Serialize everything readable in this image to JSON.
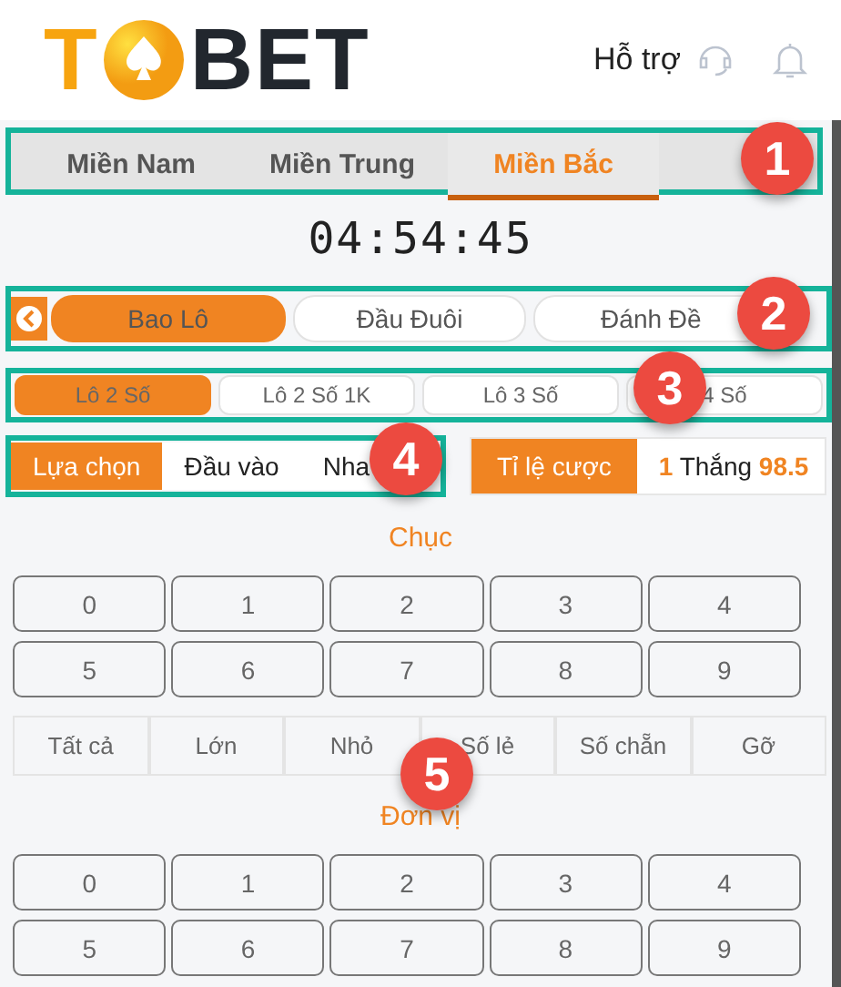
{
  "logo": {
    "before": "T",
    "after": "BET"
  },
  "header": {
    "support": "Hỗ trợ"
  },
  "region_tabs": [
    {
      "label": "Miền Nam",
      "selected": false
    },
    {
      "label": "Miền Trung",
      "selected": false
    },
    {
      "label": "Miền Bắc",
      "selected": true
    }
  ],
  "timer": "04:54:45",
  "bet_types": [
    {
      "label": "Bao Lô",
      "selected": true
    },
    {
      "label": "Đầu Đuôi",
      "selected": false
    },
    {
      "label": "Đánh Đề",
      "selected": false
    }
  ],
  "sub_types": [
    {
      "label": "Lô 2 Số",
      "selected": true
    },
    {
      "label": "Lô 2 Số 1K",
      "selected": false
    },
    {
      "label": "Lô 3 Số",
      "selected": false
    },
    {
      "label": "4 Số",
      "selected": false
    }
  ],
  "input_modes": [
    {
      "label": "Lựa chọn",
      "selected": true
    },
    {
      "label": "Đầu vào",
      "selected": false
    },
    {
      "label": "Nha",
      "selected": false
    }
  ],
  "odds": {
    "label": "Tỉ lệ cược",
    "value": "**1** Thắng **98.5**"
  },
  "sections": [
    {
      "title": "Chục",
      "digits": [
        "0",
        "1",
        "2",
        "3",
        "4",
        "5",
        "6",
        "7",
        "8",
        "9"
      ],
      "quick": [
        "Tất cả",
        "Lớn",
        "Nhỏ",
        "Số lẻ",
        "Số chẵn",
        "Gỡ"
      ]
    },
    {
      "title": "Đơn vị",
      "digits": [
        "0",
        "1",
        "2",
        "3",
        "4",
        "5",
        "6",
        "7",
        "8",
        "9"
      ]
    }
  ],
  "callouts": [
    "1",
    "2",
    "3",
    "4",
    "5"
  ]
}
